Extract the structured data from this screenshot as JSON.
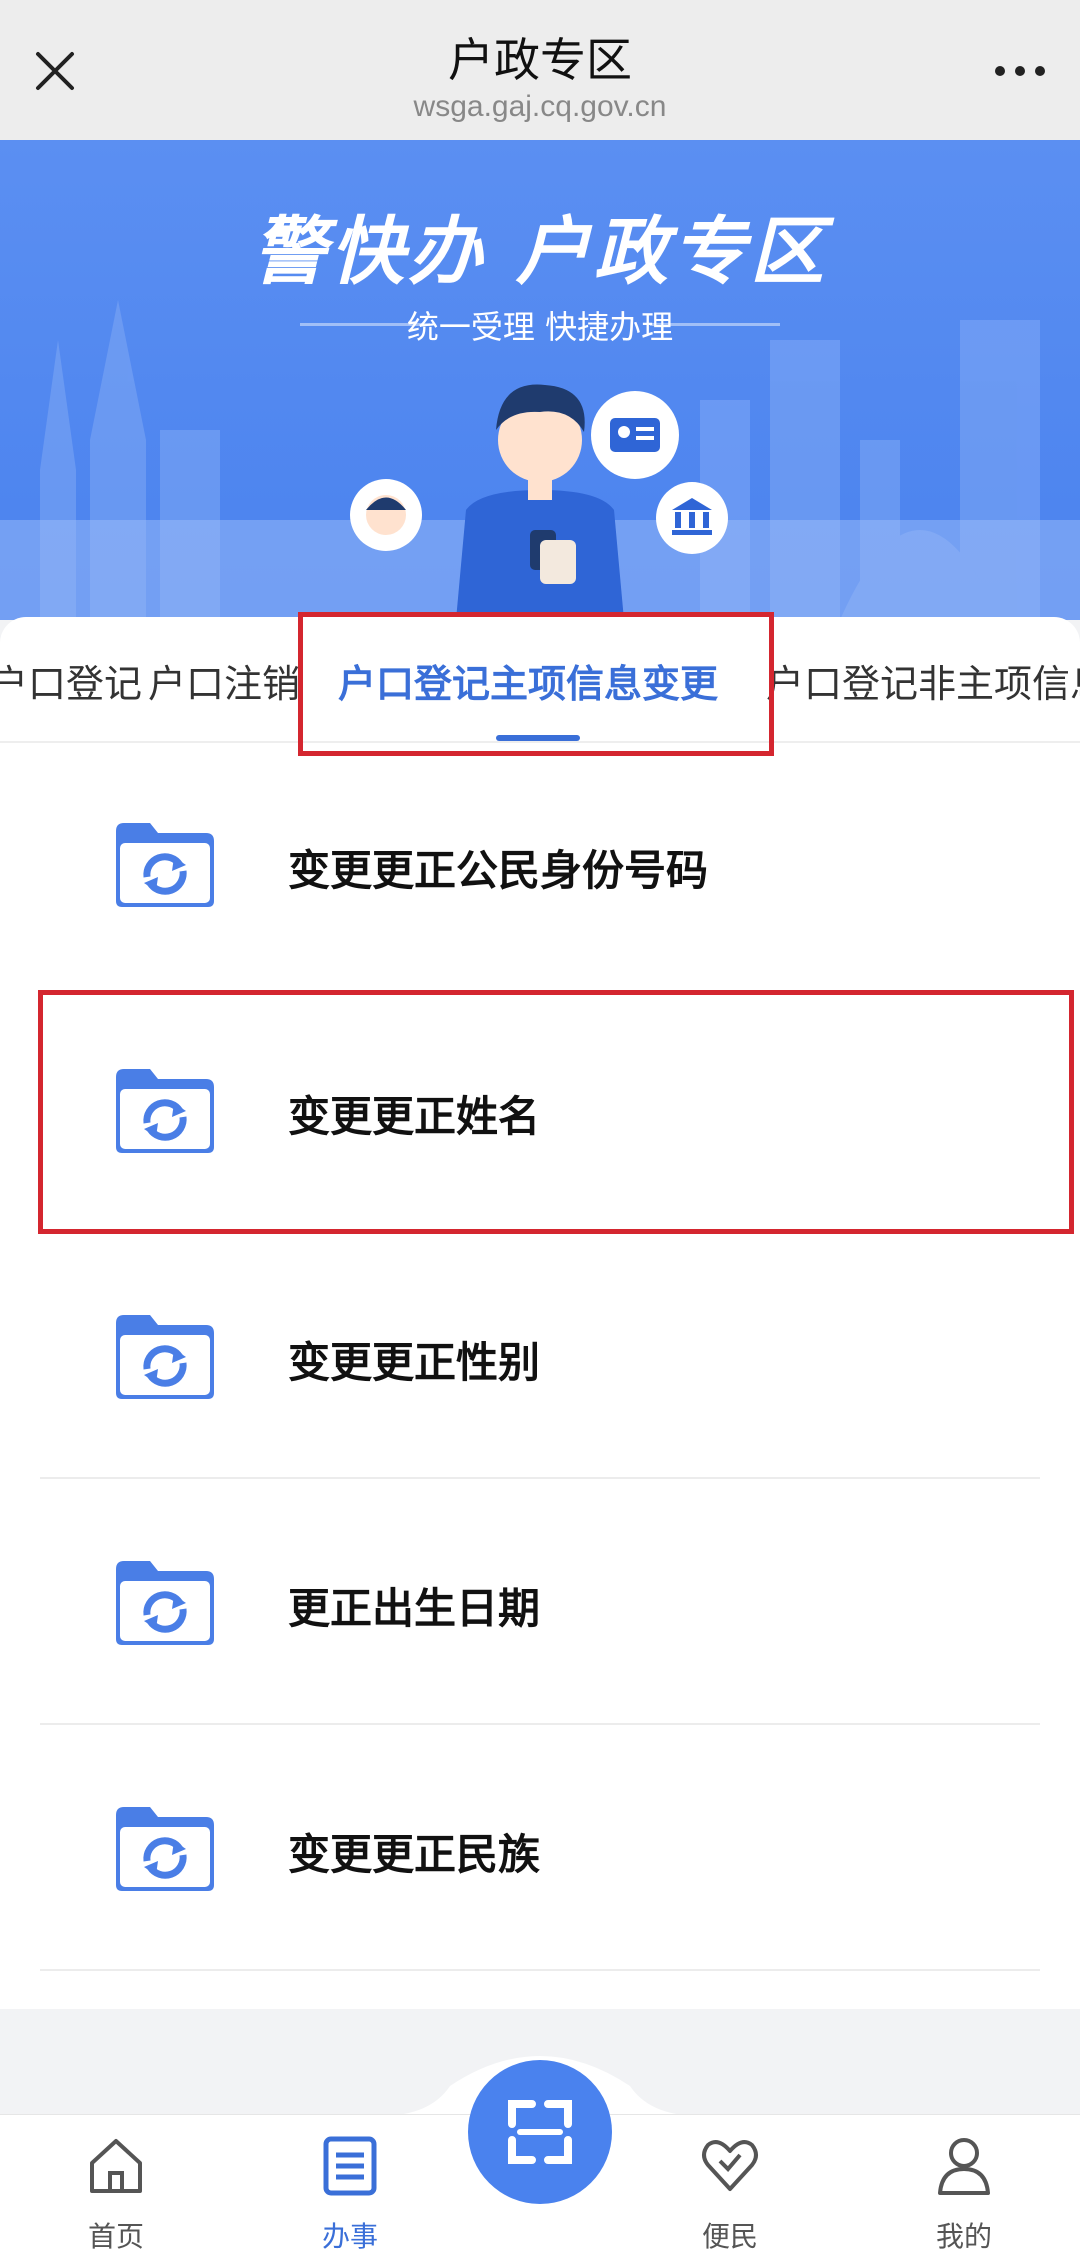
{
  "nav": {
    "title": "户政专区",
    "url": "wsga.gaj.cq.gov.cn",
    "close_icon": "close-icon",
    "more_icon": "more-icon"
  },
  "banner": {
    "brand": "警快办 户政专区",
    "subtitle": "统一受理   快捷办理"
  },
  "tabs": [
    {
      "label": "户口登记",
      "active": false
    },
    {
      "label": "户口注销",
      "active": false
    },
    {
      "label": "户口登记主项信息变更",
      "active": true
    },
    {
      "label": "户口登记非主项信息",
      "active": false
    }
  ],
  "items": [
    {
      "label": "变更更正公民身份号码",
      "icon": "folder-refresh-icon"
    },
    {
      "label": "变更更正姓名",
      "icon": "folder-refresh-icon"
    },
    {
      "label": "变更更正性别",
      "icon": "folder-refresh-icon"
    },
    {
      "label": "更正出生日期",
      "icon": "folder-refresh-icon"
    },
    {
      "label": "变更更正民族",
      "icon": "folder-refresh-icon"
    }
  ],
  "tabbar": [
    {
      "label": "首页",
      "icon": "home-icon",
      "active": false
    },
    {
      "label": "办事",
      "icon": "document-icon",
      "active": true
    },
    {
      "label": "便民",
      "icon": "heart-icon",
      "active": false
    },
    {
      "label": "我的",
      "icon": "user-icon",
      "active": false
    }
  ],
  "scan_icon": "scan-icon",
  "colors": {
    "accent": "#3a6fd8",
    "highlight": "#d4262f",
    "banner": "#4a82ee"
  }
}
